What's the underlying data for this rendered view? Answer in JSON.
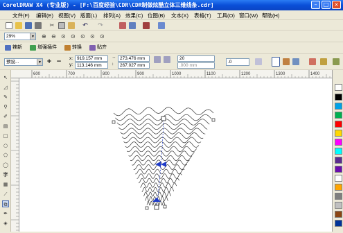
{
  "window": {
    "title": "CorelDRAW X4 (专业版) - [F:\\百度经验\\CDR\\CDR制做炫酷立体三维线条.cdr]"
  },
  "menu": [
    "文件(F)",
    "编辑(E)",
    "视图(V)",
    "版面(L)",
    "排列(A)",
    "效果(C)",
    "位图(B)",
    "文本(X)",
    "表格(T)",
    "工具(O)",
    "窗口(W)",
    "帮助(H)"
  ],
  "zoom": {
    "value": "29%"
  },
  "plugin_tabs": [
    "辣新",
    "增强插件",
    "转换",
    "贴齐"
  ],
  "property_bar": {
    "preset": "预设...",
    "x": "919.157 mm",
    "y": "113.146 mm",
    "w": "273.476 mm",
    "h": "267.027 mm",
    "steps": "20",
    "spacing": ".000 mm",
    "angle": ".0"
  },
  "ruler": {
    "ticks": [
      "600",
      "700",
      "800",
      "900",
      "1000",
      "1100",
      "1200",
      "1300",
      "1400"
    ]
  },
  "colors": {
    "titlebar": "#0a4fd8",
    "line": "#333333",
    "handle": "#1f3cc8",
    "palette": [
      "#000000",
      "#00a2e8",
      "#00b050",
      "#ff0000",
      "#ffd800",
      "#ff00ff",
      "#00ffff",
      "#5b2c8f",
      "#6a0dad",
      "#ffffff",
      "#ffa500",
      "#7f7f7f",
      "#c0c0c0",
      "#8b4513",
      "#003399"
    ]
  },
  "icons": [
    "select-tool-icon",
    "shape-tool-icon",
    "crop-tool-icon",
    "zoom-tool-icon",
    "freehand-tool-icon",
    "smart-fill-icon",
    "rectangle-tool-icon",
    "ellipse-tool-icon",
    "polygon-tool-icon",
    "text-tool-icon",
    "table-tool-icon",
    "blend-tool-icon",
    "eyedropper-tool-icon",
    "outline-tool-icon",
    "fill-tool-icon"
  ]
}
